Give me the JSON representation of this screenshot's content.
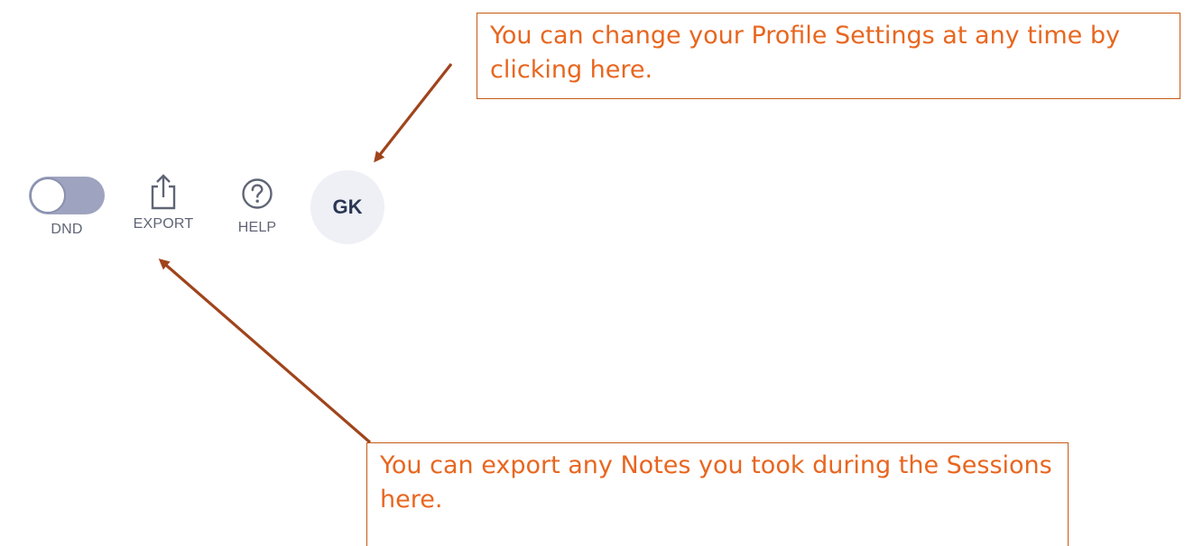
{
  "toolbar": {
    "dnd_label": "DND",
    "export_label": "EXPORT",
    "help_label": "HELP",
    "avatar_initials": "GK",
    "dnd_enabled": false
  },
  "callouts": {
    "profile_text": "You can change your Profile Settings at any time by clicking here.",
    "export_text": "You can export any Notes you took during the Sessions here."
  },
  "colors": {
    "callout_border": "#c55a11",
    "callout_text": "#e8661f",
    "arrow": "#a0441c",
    "toggle_track": "#9ea4bf",
    "avatar_bg": "#eef0f6"
  },
  "icons": {
    "export": "share-export-icon",
    "help": "question-circle-icon"
  }
}
